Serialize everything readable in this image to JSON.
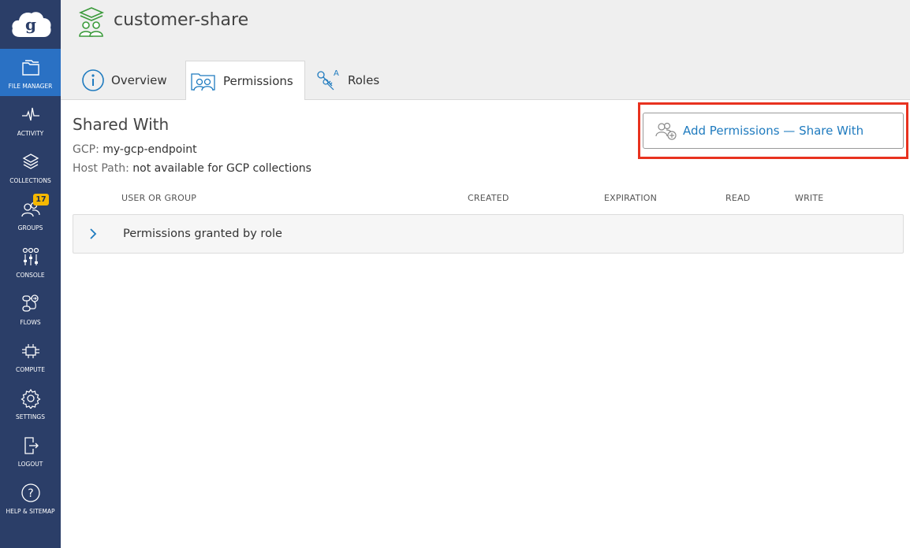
{
  "sidebar": {
    "items": [
      {
        "label": "FILE MANAGER",
        "icon": "folder-icon",
        "active": true
      },
      {
        "label": "ACTIVITY",
        "icon": "activity-pulse-icon"
      },
      {
        "label": "COLLECTIONS",
        "icon": "collections-layers-icon"
      },
      {
        "label": "GROUPS",
        "icon": "groups-icon",
        "badge": "17"
      },
      {
        "label": "CONSOLE",
        "icon": "console-sliders-icon"
      },
      {
        "label": "FLOWS",
        "icon": "flows-icon"
      },
      {
        "label": "COMPUTE",
        "icon": "compute-chip-icon"
      },
      {
        "label": "SETTINGS",
        "icon": "gear-icon"
      },
      {
        "label": "LOGOUT",
        "icon": "logout-icon"
      },
      {
        "label": "HELP & SITEMAP",
        "icon": "help-icon"
      }
    ]
  },
  "header": {
    "title": "customer-share",
    "tabs": [
      {
        "label": "Overview",
        "icon": "info-icon"
      },
      {
        "label": "Permissions",
        "icon": "permissions-icon",
        "active": true
      },
      {
        "label": "Roles",
        "icon": "roles-keys-icon"
      }
    ]
  },
  "main": {
    "section_title": "Shared With",
    "gcp_key": "GCP:",
    "gcp_value": "my-gcp-endpoint",
    "host_key": "Host Path:",
    "host_value": "not available for GCP collections",
    "add_button_label": "Add Permissions — Share With",
    "columns": [
      "USER OR GROUP",
      "CREATED",
      "EXPIRATION",
      "READ",
      "WRITE"
    ],
    "rows": [
      {
        "label": "Permissions granted by role"
      }
    ]
  },
  "colors": {
    "sidebar_bg": "#2b3e68",
    "sidebar_active": "#2a71c4",
    "badge": "#f5b800",
    "link_blue": "#1f7bbf",
    "highlight_red": "#e8321f",
    "collection_green": "#3a9a3a"
  }
}
